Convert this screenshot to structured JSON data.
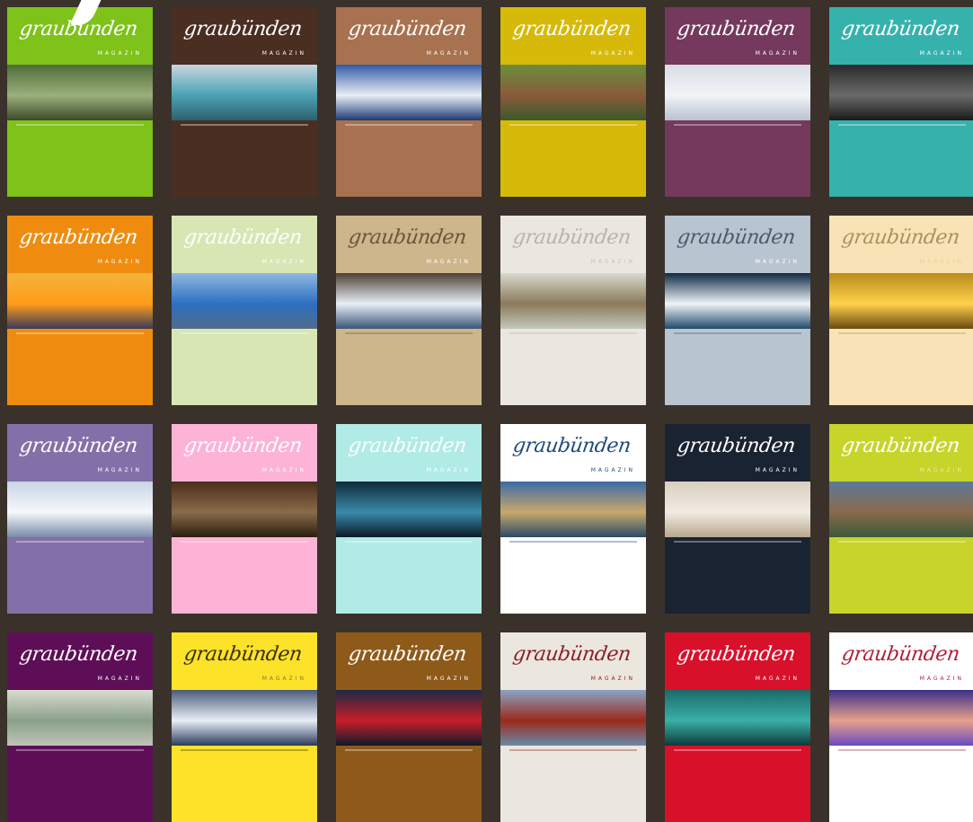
{
  "brand": {
    "logo": "graubünden",
    "subtitle": "MAGAZIN"
  },
  "covers": [
    {
      "top": "#7ec21a",
      "bottom": "#7ec21a",
      "photo": [
        "#4f6a3a",
        "#9bb07a",
        "#3c4a2a"
      ],
      "logo_color": "#ffffff",
      "sub_color": "#ffffff"
    },
    {
      "top": "#4a2e22",
      "bottom": "#4a2e22",
      "photo": [
        "#c9d6e0",
        "#4aa2b3",
        "#2e5f6f"
      ],
      "logo_color": "#ffffff",
      "sub_color": "#ffffff"
    },
    {
      "top": "#a8714f",
      "bottom": "#a8714f",
      "photo": [
        "#2f5aa8",
        "#e9eef7",
        "#1d3a76"
      ],
      "logo_color": "#ffffff",
      "sub_color": "#ffffff"
    },
    {
      "top": "#d7b90a",
      "bottom": "#d7b90a",
      "photo": [
        "#6a8e3a",
        "#8a5a3a",
        "#3a5a2a"
      ],
      "logo_color": "#ffffff",
      "sub_color": "#ffffff"
    },
    {
      "top": "#74395c",
      "bottom": "#74395c",
      "photo": [
        "#d8dde6",
        "#f2f4f7",
        "#b8c1cf"
      ],
      "logo_color": "#ffffff",
      "sub_color": "#ffffff"
    },
    {
      "top": "#36b2ad",
      "bottom": "#36b2ad",
      "photo": [
        "#2a2a2a",
        "#6a6a6a",
        "#1a1a1a"
      ],
      "logo_color": "#ffffff",
      "sub_color": "#ffffff"
    },
    {
      "top": "#ef8c0f",
      "bottom": "#ef8c0f",
      "photo": [
        "#f4b33a",
        "#ff9c1a",
        "#3a3a5a"
      ],
      "logo_color": "#ffffff",
      "sub_color": "#ffffff"
    },
    {
      "top": "#d7e6b3",
      "bottom": "#d7e6b3",
      "photo": [
        "#8fb8e0",
        "#2d6fc2",
        "#506c8a"
      ],
      "logo_color": "#ffffff",
      "sub_color": "#ffffff"
    },
    {
      "top": "#cdb58c",
      "bottom": "#cdb58c",
      "photo": [
        "#4b4035",
        "#e8eef5",
        "#3a5478"
      ],
      "logo_color": "#6b5538",
      "sub_color": "#ffffff"
    },
    {
      "top": "#ebe7e0",
      "bottom": "#ebe7e0",
      "photo": [
        "#d8d9cf",
        "#8b7a5a",
        "#c4c8bc"
      ],
      "logo_color": "#b9b3a9",
      "sub_color": "#c9c4bb"
    },
    {
      "top": "#b8c4d0",
      "bottom": "#b8c4d0",
      "photo": [
        "#0f2a44",
        "#f0f4f8",
        "#1f4a6a"
      ],
      "logo_color": "#4a5a6a",
      "sub_color": "#ffffff"
    },
    {
      "top": "#f9e3b6",
      "bottom": "#f9e3b6",
      "photo": [
        "#b88d1a",
        "#ffd14d",
        "#6a4a10"
      ],
      "logo_color": "#a89060",
      "sub_color": "#e8d29a"
    },
    {
      "top": "#8470a8",
      "bottom": "#8470a8",
      "photo": [
        "#c9d4e4",
        "#f6f8fb",
        "#7a8aa8"
      ],
      "logo_color": "#ffffff",
      "sub_color": "#ffffff"
    },
    {
      "top": "#fcb3d6",
      "bottom": "#fcb3d6",
      "photo": [
        "#4a2e1a",
        "#8a6a4a",
        "#2a1e10"
      ],
      "logo_color": "#ffffff",
      "sub_color": "#ffffff"
    },
    {
      "top": "#b0ebe6",
      "bottom": "#b0ebe6",
      "photo": [
        "#0e2a3a",
        "#3a8aaa",
        "#0a1a28"
      ],
      "logo_color": "#ffffff",
      "sub_color": "#ffffff"
    },
    {
      "top": "#ffffff",
      "bottom": "#ffffff",
      "photo": [
        "#3a6aa8",
        "#c9a86a",
        "#2a4a6a"
      ],
      "logo_color": "#1e4a7a",
      "sub_color": "#1e4a7a"
    },
    {
      "top": "#1a2332",
      "bottom": "#1a2332",
      "photo": [
        "#d8cfc0",
        "#f0ebe3",
        "#b8a88a"
      ],
      "logo_color": "#ffffff",
      "sub_color": "#ffffff"
    },
    {
      "top": "#c7d42a",
      "bottom": "#c7d42a",
      "photo": [
        "#5a7a9a",
        "#8a6a4a",
        "#3a5a3a"
      ],
      "logo_color": "#ffffff",
      "sub_color": "#e9ee9a"
    },
    {
      "top": "#5e0e57",
      "bottom": "#5e0e57",
      "photo": [
        "#d9dccf",
        "#8aa08a",
        "#bfc4b6"
      ],
      "logo_color": "#ffffff",
      "sub_color": "#ffffff"
    },
    {
      "top": "#fde22a",
      "bottom": "#fde22a",
      "photo": [
        "#4a5a7a",
        "#e8eef5",
        "#2a3a5a"
      ],
      "logo_color": "#3a2e10",
      "sub_color": "#8a7a20"
    },
    {
      "top": "#8e5a1a",
      "bottom": "#8e5a1a",
      "photo": [
        "#1a2a44",
        "#c91e2a",
        "#0e1a2a"
      ],
      "logo_color": "#ffffff",
      "sub_color": "#ffffff"
    },
    {
      "top": "#ece7de",
      "bottom": "#ece7de",
      "photo": [
        "#8aa4c4",
        "#9a2a1a",
        "#6a8aa8"
      ],
      "logo_color": "#8a1e2a",
      "sub_color": "#8a1e2a"
    },
    {
      "top": "#d8102a",
      "bottom": "#d8102a",
      "photo": [
        "#1a6a6a",
        "#3ab0a8",
        "#0e3a3a"
      ],
      "logo_color": "#ffffff",
      "sub_color": "#ffffff"
    },
    {
      "top": "#ffffff",
      "bottom": "#ffffff",
      "photo": [
        "#3a2e8a",
        "#e8a08a",
        "#6a4ac0"
      ],
      "logo_color": "#b01e3a",
      "sub_color": "#b01e3a"
    }
  ]
}
